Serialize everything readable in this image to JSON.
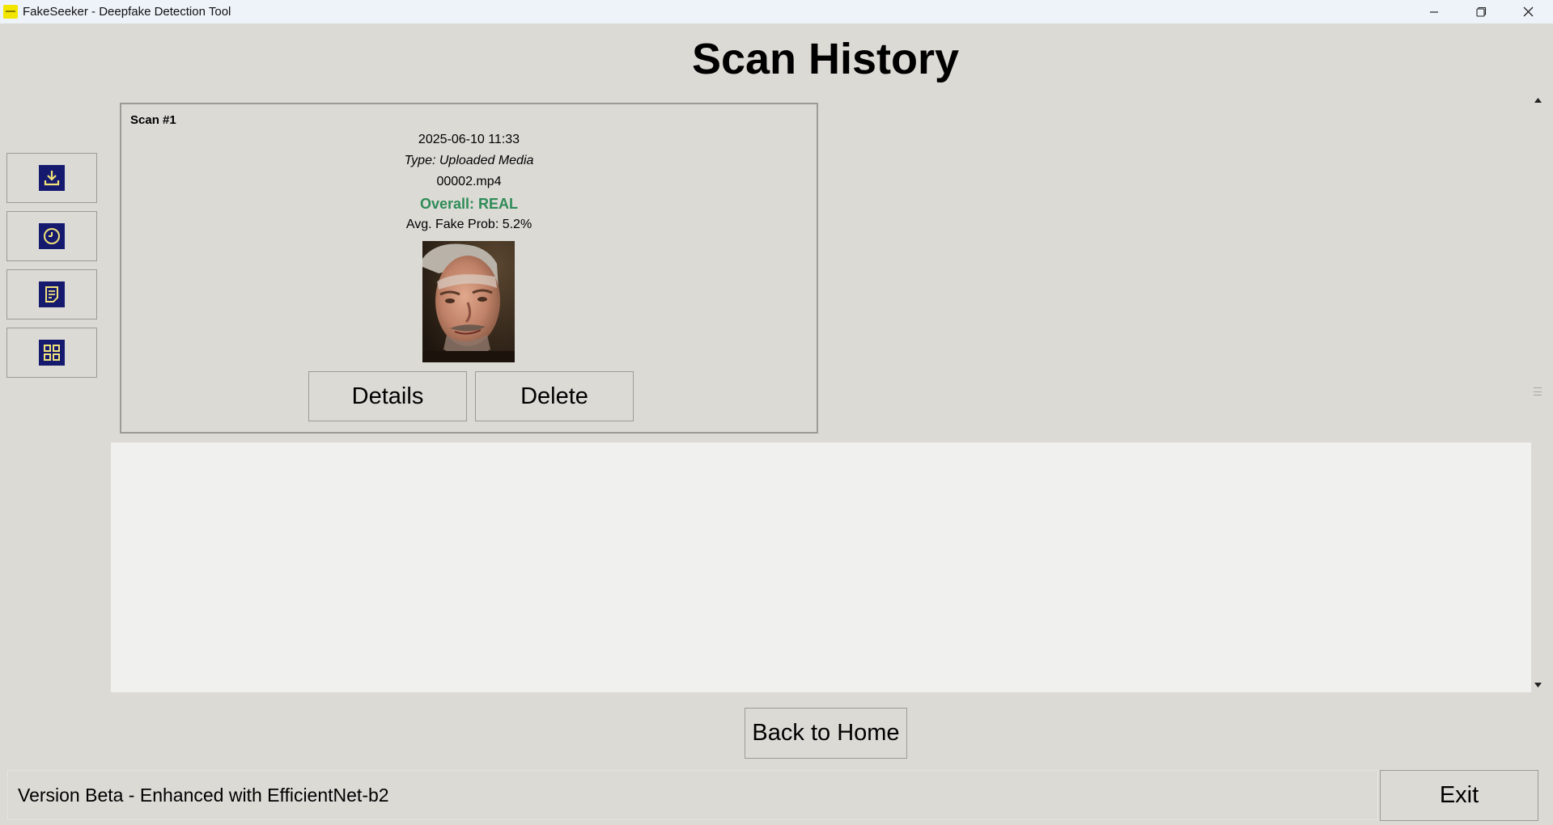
{
  "window": {
    "title": "FakeSeeker - Deepfake Detection Tool",
    "controls": [
      "minimize-icon",
      "restore-icon",
      "close-icon"
    ]
  },
  "page": {
    "title": "Scan History"
  },
  "sidebar": {
    "items": [
      {
        "icon": "download-icon"
      },
      {
        "icon": "clock-icon"
      },
      {
        "icon": "report-icon"
      },
      {
        "icon": "grid-icon"
      }
    ],
    "icon_colors": {
      "background": "#151a6e",
      "foreground": "#f2e37a"
    }
  },
  "scans": [
    {
      "title": "Scan #1",
      "datetime": "2025-06-10 11:33",
      "type": "Type: Uploaded Media",
      "filename": "00002.mp4",
      "overall": "Overall: REAL",
      "overall_color": "#2e8b57",
      "avg_prob": "Avg. Fake Prob: 5.2%",
      "thumbnail": "face-thumbnail",
      "details_label": "Details",
      "delete_label": "Delete"
    }
  ],
  "actions": {
    "back_label": "Back to Home",
    "exit_label": "Exit"
  },
  "footer": {
    "version": "Version Beta - Enhanced with EfficientNet-b2"
  }
}
